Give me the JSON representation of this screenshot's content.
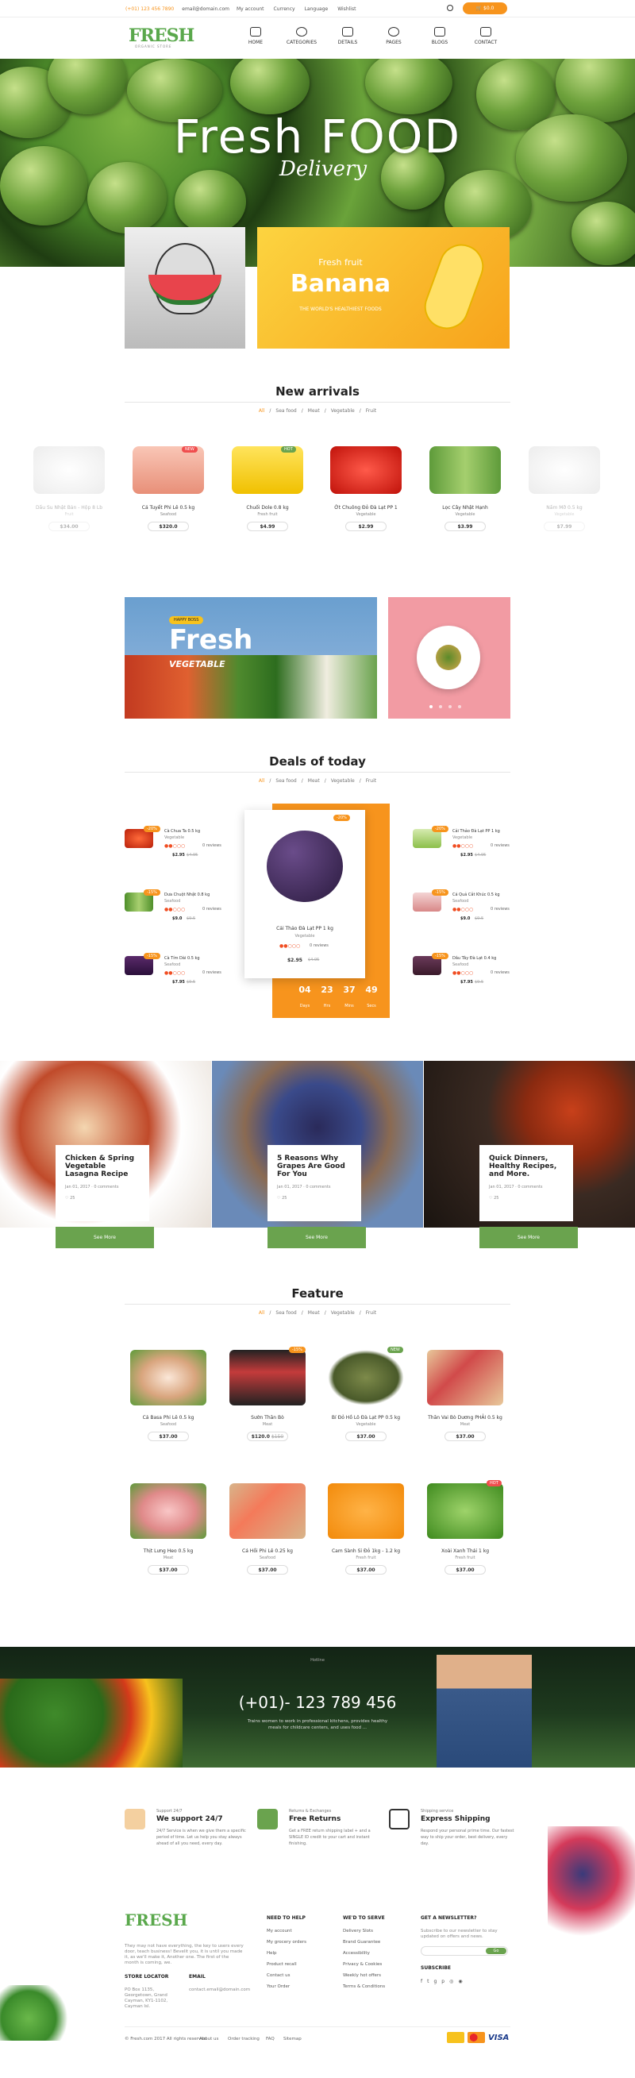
{
  "topbar": {
    "phone": "(+01) 123 456 7890",
    "email": "email@domain.com",
    "links": [
      "My account",
      "Currency",
      "Language",
      "Wishlist"
    ],
    "cart": "$0.0"
  },
  "header": {
    "logo": "FRESH",
    "logo_sub": "ORGANIC STORE",
    "nav": [
      "HOME",
      "CATEGORIES",
      "DETAILS",
      "PAGES",
      "BLOGS",
      "CONTACT"
    ]
  },
  "hero": {
    "title": "Fresh FOOD",
    "subtitle": "Delivery"
  },
  "banner": {
    "small": "Fresh fruit",
    "big": "Banana",
    "line": "THE WORLD'S HEALTHIEST FOODS"
  },
  "arrivals": {
    "title": "New arrivals",
    "crumbs": [
      "All",
      "Sea food",
      "Meat",
      "Vegetable",
      "Fruit"
    ],
    "products": [
      {
        "name": "Dấu Su Nhật Bản - Hộp 8 Lb",
        "cat": "Fruit",
        "price": "$34.00"
      },
      {
        "name": "Cá Tuyết Phi Lê 0.5 kg",
        "cat": "Seafood",
        "price": "$320.0",
        "tag": "NEW"
      },
      {
        "name": "Chuối Dole 0.8 kg",
        "cat": "Fresh fruit",
        "price": "$4.99",
        "tag": "HOT"
      },
      {
        "name": "Ớt Chuông Đỏ Đà Lạt PP 1",
        "cat": "Vegetable",
        "price": "$2.99"
      },
      {
        "name": "Lọc Cây Nhật Hạnh",
        "cat": "Vegetable",
        "price": "$3.99"
      },
      {
        "name": "Nấm Mỡ 0.5 kg",
        "cat": "Vegetable",
        "price": "$7.99"
      }
    ]
  },
  "promo": {
    "badge": "HAPPY BOSS",
    "title": "Fresh",
    "sub": "VEGETABLE"
  },
  "deals": {
    "title": "Deals of today",
    "crumbs": [
      "All",
      "Sea food",
      "Meat",
      "Vegetable",
      "Fruit"
    ],
    "left": [
      {
        "name": "Cà Chua Ta 0.5 kg",
        "cat": "Vegetable",
        "price": "$2.95",
        "old": "$4.95",
        "reviews": "0 reviews",
        "tag": "-20%"
      },
      {
        "name": "Dưa Chuột Nhật 0.8 kg",
        "cat": "Seafood",
        "price": "$9.0",
        "old": "$9.5",
        "reviews": "0 reviews",
        "tag": "-15%"
      },
      {
        "name": "Cà Tím Dài 0.5 kg",
        "cat": "Seafood",
        "price": "$7.95",
        "old": "$9.5",
        "reviews": "0 reviews",
        "tag": "-15%"
      }
    ],
    "right": [
      {
        "name": "Cải Thảo Đà Lạt PP 1 kg",
        "cat": "Vegetable",
        "price": "$2.95",
        "old": "$4.95",
        "reviews": "0 reviews",
        "tag": "-20%"
      },
      {
        "name": "Cá Quả Cắt Khúc 0.5 kg",
        "cat": "Seafood",
        "price": "$9.0",
        "old": "$9.5",
        "reviews": "0 reviews",
        "tag": "-15%"
      },
      {
        "name": "Dâu Tây Đà Lạt 0.4 kg",
        "cat": "Seafood",
        "price": "$7.95",
        "old": "$9.5",
        "reviews": "0 reviews",
        "tag": "-15%"
      }
    ],
    "center": {
      "name": "Cải Thảo Đà Lạt PP 1 kg",
      "cat": "Vegetable",
      "price": "$2.95",
      "old": "$4.95",
      "reviews": "0 reviews",
      "tag": "-20%"
    },
    "countdown": [
      {
        "v": "04",
        "u": "Days"
      },
      {
        "v": "23",
        "u": "Hrs"
      },
      {
        "v": "37",
        "u": "Mins"
      },
      {
        "v": "49",
        "u": "Secs"
      }
    ]
  },
  "blogs": [
    {
      "title": "Chicken & Spring Vegetable Lasagna Recipe",
      "date": "Jan 01, 2017",
      "comments": "0 comments",
      "likes": "25",
      "btn": "See More"
    },
    {
      "title": "5 Reasons Why Grapes Are Good For You",
      "date": "Jan 01, 2017",
      "comments": "0 comments",
      "likes": "25",
      "btn": "See More"
    },
    {
      "title": "Quick Dinners, Healthy Recipes, and More.",
      "date": "Jan 01, 2017",
      "comments": "0 comments",
      "likes": "25",
      "btn": "See More"
    }
  ],
  "feature": {
    "title": "Feature",
    "crumbs": [
      "All",
      "Sea food",
      "Meat",
      "Vegetable",
      "Fruit"
    ],
    "products": [
      {
        "name": "Cá Basa Phi Lê 0.5 kg",
        "cat": "Seafood",
        "price": "$37.00"
      },
      {
        "name": "Sườn Thăn Bò",
        "cat": "Meat",
        "price": "$120.0",
        "old": "$150",
        "tag": "-15%"
      },
      {
        "name": "Bí Đỏ Hồ Lô Đà Lạt PP 0.5 kg",
        "cat": "Vegetable",
        "price": "$37.00",
        "tag": "NEW"
      },
      {
        "name": "Thăn Vai Bò Dương PHẢI 0.5 kg",
        "cat": "Meat",
        "price": "$37.00"
      },
      {
        "name": "Thịt Lưng Heo 0.5 kg",
        "cat": "Meat",
        "price": "$37.00"
      },
      {
        "name": "Cá Hồi Phi Lê 0.25 kg",
        "cat": "Seafood",
        "price": "$37.00"
      },
      {
        "name": "Cam Sành Sỉ Đỏ 1kg - 1.2 kg",
        "cat": "Fresh fruit",
        "price": "$37.00"
      },
      {
        "name": "Xoài Xanh Thái 1 kg",
        "cat": "Fresh fruit",
        "price": "$37.00",
        "tag": "HOT"
      }
    ]
  },
  "hotline": {
    "label": "Hotline",
    "phone": "(+01)- 123 789 456",
    "desc": "Trains women to work in professional kitchens, provides healthy meals for childcare centers, and uses food ..."
  },
  "services": [
    {
      "small": "Support 24/7",
      "head": "We support 24/7",
      "desc": "24/7 Service is when we give them a specific period of time. Let us help you stay always ahead of all you need, every day."
    },
    {
      "small": "Returns & Exchanges",
      "head": "Free Returns",
      "desc": "Get a FREE return shipping label + and a SINGLE ID credit to your cart and instant finishing."
    },
    {
      "small": "Shipping service",
      "head": "Express Shipping",
      "desc": "Respond your personal prime time. Our fastest way to ship your order, best delivery, every day."
    }
  ],
  "footer": {
    "logo": "FRESH",
    "about": "They may not have everything, the key to users every door, teach business! Bevelit you, it is until you made it, as we'll make it, Another one. The first of the month is coming, we.",
    "store_h": "STORE LOCATOR",
    "store": "PO Box 1135, Georgetown, Grand Cayman, KY1-1102, Cayman Isl.",
    "email_h": "EMAIL",
    "emails": "contact.email@domain.com",
    "help_h": "NEED TO HELP",
    "help": [
      "My account",
      "My grocery orders",
      "Help",
      "Product recall",
      "Contact us",
      "Your Order"
    ],
    "serve_h": "WE'D TO SERVE",
    "serve": [
      "Delivery Slots",
      "Brand Guarantee",
      "Accessibility",
      "Privacy & Cookies",
      "Weekly hot offers",
      "Terms & Conditions"
    ],
    "news_h": "GET A NEWSLETTER?",
    "news": "Subscribe to our newsletter to stay updated on offers and news.",
    "news_btn": "Go",
    "sub_h": "SUBSCRIBE",
    "copy": "© Fresh.com 2017 All rights reserved",
    "links": [
      "About us",
      "Order tracking",
      "FAQ",
      "Sitemap"
    ],
    "pay": "VISA"
  }
}
